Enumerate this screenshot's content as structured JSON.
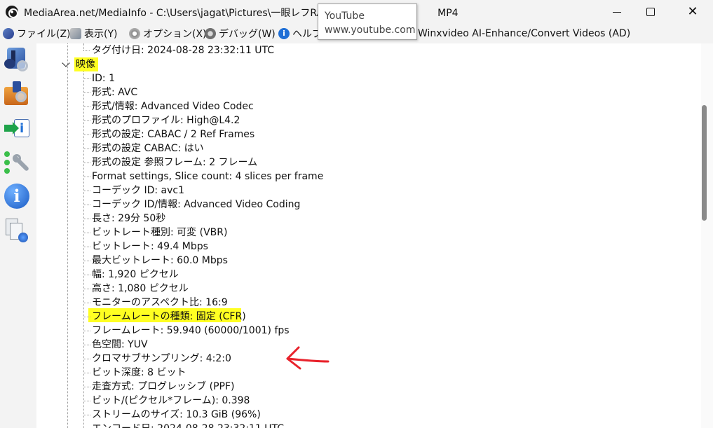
{
  "window": {
    "title": "MediaArea.net/MediaInfo - C:\\Users\\jagat\\Pictures\\一眼レフRAW",
    "title_tail": "MP4"
  },
  "menu": {
    "file": "ファイル(Z)",
    "view": "表示(Y)",
    "options": "オプション(X)",
    "debug": "デバッグ(W)",
    "help": "ヘルプ",
    "ad": "Winxvideo AI-Enhance/Convert Videos (AD)"
  },
  "tooltip": {
    "title": "YouTube",
    "url": "www.youtube.com"
  },
  "toolbar_icons": [
    "audio-file-icon",
    "open-folder-icon",
    "export-info-icon",
    "preferences-icon",
    "about-info-icon",
    "web-knowledge-icon"
  ],
  "tree": {
    "tagged_date": "タグ付け日: 2024-08-28 23:32:11 UTC",
    "section": "映像",
    "rows": [
      "ID: 1",
      "形式: AVC",
      "形式/情報: Advanced Video Codec",
      "形式のプロファイル: High@L4.2",
      "形式の設定: CABAC / 2 Ref Frames",
      "形式の設定 CABAC: はい",
      "形式の設定 参照フレーム: 2 フレーム",
      "Format settings, Slice count: 4 slices per frame",
      "コーデック ID: avc1",
      "コーデック ID/情報: Advanced Video Coding",
      "長さ: 29分 50秒",
      "ビットレート種別: 可変 (VBR)",
      "ビットレート: 49.4 Mbps",
      "最大ビットレート: 60.0 Mbps",
      "幅: 1,920 ピクセル",
      "高さ: 1,080 ピクセル",
      "モニターのアスペクト比: 16:9",
      "フレームレートの種類: 固定 (CFR)",
      "フレームレート: 59.940 (60000/1001) fps",
      "色空間: YUV",
      "クロマサブサンプリング: 4:2:0",
      "ビット深度: 8 ビット",
      "走査方式: プログレッシブ (PPF)",
      "ビット/(ピクセル*フレーム): 0.398",
      "ストリームのサイズ: 10.3 GiB (96%)",
      "エンコード日: 2024-08-28 23:32:11 UTC"
    ]
  },
  "colors": {
    "highlight": "#ffff22",
    "annotation_arrow": "#e8222b"
  }
}
